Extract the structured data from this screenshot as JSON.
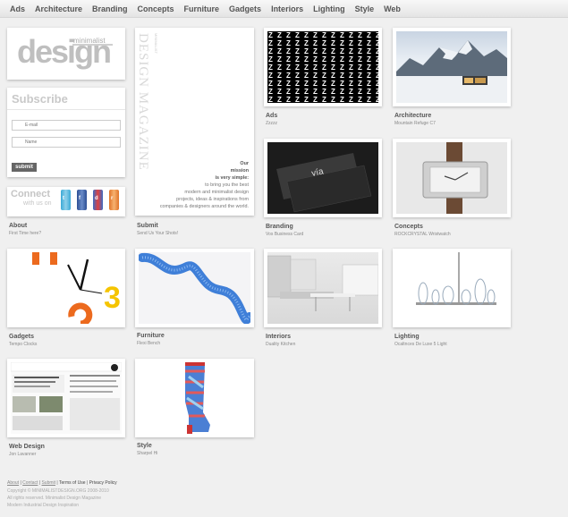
{
  "nav": [
    "Ads",
    "Architecture",
    "Branding",
    "Concepts",
    "Furniture",
    "Gadgets",
    "Interiors",
    "Lighting",
    "Style",
    "Web"
  ],
  "logo": {
    "word": "design",
    "tag": "minimalist"
  },
  "subscribe": {
    "title": "Subscribe",
    "email_placeholder": "E-mail",
    "name_placeholder": "Name",
    "button": "submit"
  },
  "connect": {
    "title": "Connect",
    "sub": "with us on"
  },
  "about": {
    "title": "About",
    "sub": "First Time here?"
  },
  "submit": {
    "title": "Submit",
    "sub": "Send Us Your Shots!"
  },
  "magazine": {
    "vertical": "DESIGN MAGAZINE",
    "small": "MINIMALIST",
    "mission_lines": [
      "Our",
      "mission",
      "is very simple:",
      "to bring you the best",
      "modern and minimalist design",
      "projects, ideas & inspirations from",
      "companies & designers around the world."
    ]
  },
  "posts": [
    {
      "category": "Ads",
      "sub": "Zzzzz"
    },
    {
      "category": "Architecture",
      "sub": "Mountain Refuge C7"
    },
    {
      "category": "Branding",
      "sub": "Vos Business Card"
    },
    {
      "category": "Concepts",
      "sub": "ROCKCRYSTAL Wristwatch"
    },
    {
      "category": "Gadgets",
      "sub": "Tempo Clocks"
    },
    {
      "category": "Furniture",
      "sub": "Flexi Bench"
    },
    {
      "category": "Interiors",
      "sub": "Duality Kitchen"
    },
    {
      "category": "Lighting",
      "sub": "Ocaltnces De Luxe 5 Light"
    },
    {
      "category": "Web Design",
      "sub": "Jon Lavanner"
    },
    {
      "category": "Style",
      "sub": "Sharpel Hi"
    }
  ],
  "footer": {
    "links": [
      "About",
      "Contact",
      "Submit",
      "Terms of Use",
      "Privacy Policy"
    ],
    "copyright": "Copyright © MINIMALISTDESIGN.ORG 2008-2010",
    "rights": "All rights reserved. Minimalist Design Magazine",
    "tagline": "Modern Industrial Design Inspiration"
  }
}
